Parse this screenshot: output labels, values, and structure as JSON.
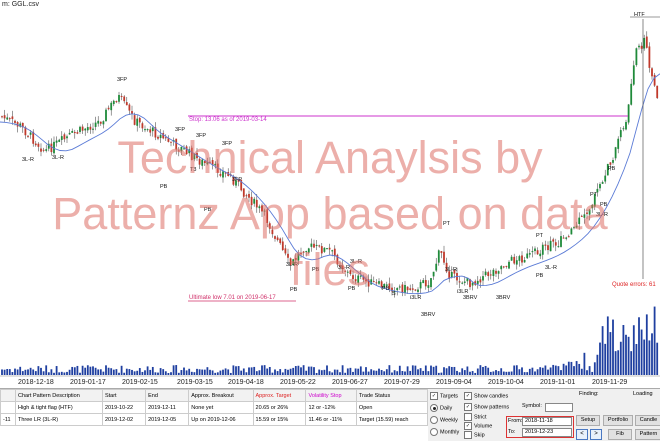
{
  "window": {
    "title": "m: GGL.csv"
  },
  "chart": {
    "watermark_lines": [
      "Technical Anaylsis by",
      "Patternz App based on data",
      "files"
    ],
    "stop_line": {
      "label": "Stop: 13.06 as of 2019-03-14",
      "color": "#cc33cc"
    },
    "ultimate_low": {
      "label": "Ultimate low 7.01 on 2019-06-17",
      "color": "#d0306a"
    },
    "htf_label": "HTF",
    "quote_errors": "Quote errors: 61",
    "date_labels": [
      "2018-12-18",
      "2019-01-17",
      "2019-02-15",
      "2019-03-15",
      "2019-04-18",
      "2019-05-22",
      "2019-06-27",
      "2019-07-29",
      "2019-09-04",
      "2019-10-04",
      "2019-11-01",
      "2019-11-29"
    ],
    "pattern_labels": [
      "3FP",
      "3L-R",
      "3L-R",
      "3FP",
      "3FP",
      "3FP",
      "3FP",
      "T3",
      "PB",
      "PB",
      "PB",
      "PB",
      "3L-R",
      "3L-R",
      "PT",
      "PT",
      "PT",
      "PB",
      "PB",
      "PB",
      "S",
      "3BRV",
      "3BRV",
      "3BRV",
      "i3LR",
      "i3LR",
      "3L-R",
      "3L-R",
      "PB",
      "PB",
      "3L-R",
      "3L-R"
    ],
    "colors": {
      "up": "#1f8a3a",
      "down": "#c0392b",
      "ma": "#5b7bd6",
      "volume": "#1f3fa0"
    }
  },
  "table": {
    "headers": [
      "",
      "Chart Pattern Description",
      "Start",
      "End",
      "Approx. Breakout",
      "Approx. Target",
      "Volatility Stop",
      "Trade Status"
    ],
    "rows": [
      [
        "",
        "High & tight flag (HTF)",
        "2019-10-22",
        "2019-12-11",
        "None yet",
        "20.65 or 26%",
        "12 or -12%",
        "Open"
      ],
      [
        "-11",
        "Three LR (3L-R)",
        "2019-12-02",
        "2019-12-05",
        "Up on 2019-12-06",
        "15.59 or 15%",
        "11.46 or -11%",
        "Target (15.59) reach"
      ]
    ]
  },
  "controls": {
    "targets": "Targets",
    "daily": "Daily",
    "weekly": "Weekly",
    "monthly": "Monthly",
    "show_candles": "Show candles",
    "show_patterns": "Show patterns",
    "strict": "Strict",
    "volume": "Volume",
    "skip": "Skip",
    "symbol": "Symbol:",
    "finding": "Finding:",
    "loading": "Loading",
    "from_label": "From:",
    "from_value": "2018-11-18",
    "to_label": "To:",
    "to_value": "2019-12-23",
    "setup": "Setup",
    "portfolio": "Portfolio",
    "candles": "Candle",
    "fib": "Fib",
    "patterns": "Pattern",
    "prev": "<",
    "next": ">"
  }
}
